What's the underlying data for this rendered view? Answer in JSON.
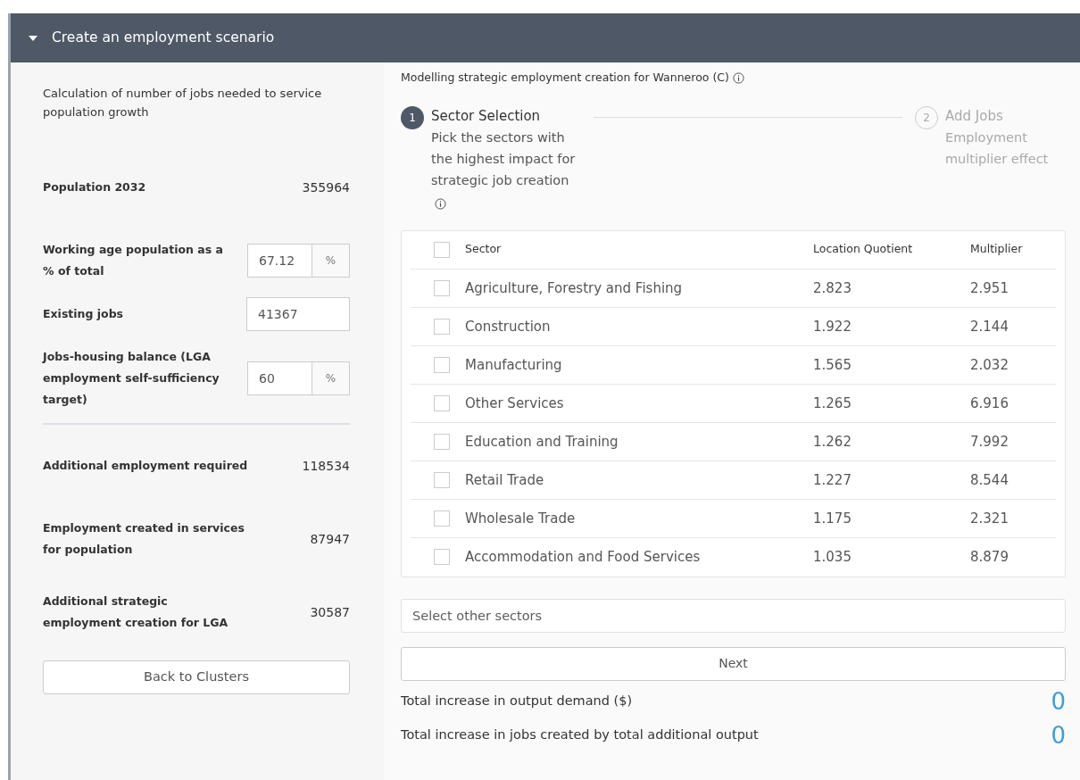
{
  "panel": {
    "title": "Create an employment scenario",
    "expanded": true
  },
  "calculator": {
    "intro": "Calculation of number of jobs needed to service population growth",
    "fields": [
      {
        "kind": "stat",
        "label": "Population 2032",
        "value": "355964"
      },
      {
        "kind": "input",
        "label": "Working age population as a % of total",
        "value": "67.12",
        "unit": "%"
      },
      {
        "kind": "input",
        "label": "Existing jobs",
        "value": "41367"
      },
      {
        "kind": "input",
        "label": "Jobs-housing balance (LGA employment self-sufficiency target)",
        "value": "60",
        "unit": "%"
      },
      {
        "kind": "divider"
      },
      {
        "kind": "stat",
        "label": "Additional employment required",
        "value": "118534"
      },
      {
        "kind": "stat",
        "label": "Employment created in services for population",
        "value": "87947"
      },
      {
        "kind": "stat",
        "label": "Additional strategic employment creation for LGA",
        "value": "30587"
      }
    ],
    "back_button": "Back to Clusters"
  },
  "modelling": {
    "title": "Modelling strategic employment creation for Wanneroo (C)",
    "steps": [
      {
        "number": "1",
        "title": "Sector Selection",
        "description": "Pick the sectors with the highest impact for strategic job creation",
        "selected": true
      },
      {
        "number": "2",
        "title": "Add Jobs",
        "description": "Employment multiplier effect",
        "selected": false
      }
    ],
    "table": {
      "columns": [
        "Sector",
        "Location Quotient",
        "Multiplier"
      ],
      "all_checked": false,
      "rows": [
        {
          "checked": false,
          "cells": [
            "Agriculture, Forestry and Fishing",
            "2.823",
            "2.951"
          ]
        },
        {
          "checked": false,
          "cells": [
            "Construction",
            "1.922",
            "2.144"
          ]
        },
        {
          "checked": false,
          "cells": [
            "Manufacturing",
            "1.565",
            "2.032"
          ]
        },
        {
          "checked": false,
          "cells": [
            "Other Services",
            "1.265",
            "6.916"
          ]
        },
        {
          "checked": false,
          "cells": [
            "Education and Training",
            "1.262",
            "7.992"
          ]
        },
        {
          "checked": false,
          "cells": [
            "Retail Trade",
            "1.227",
            "8.544"
          ]
        },
        {
          "checked": false,
          "cells": [
            "Wholesale Trade",
            "1.175",
            "2.321"
          ]
        },
        {
          "checked": false,
          "cells": [
            "Accommodation and Food Services",
            "1.035",
            "8.879"
          ]
        }
      ]
    },
    "other_sectors": {
      "placeholder": "Select other sectors"
    },
    "next_button": "Next",
    "totals": [
      {
        "label": "Total increase in output demand ($)",
        "value": "0"
      },
      {
        "label": "Total increase in jobs created by total additional output",
        "value": "0"
      }
    ]
  }
}
